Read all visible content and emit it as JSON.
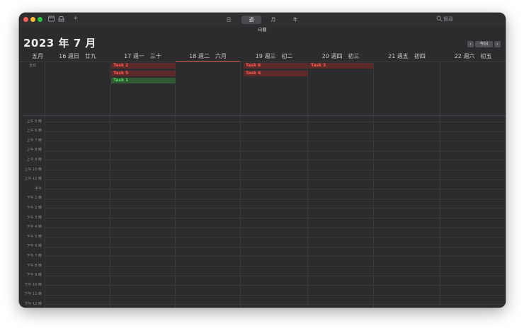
{
  "toolbar": {
    "views": [
      {
        "label": "日",
        "active": false
      },
      {
        "label": "週",
        "active": true
      },
      {
        "label": "月",
        "active": false
      },
      {
        "label": "年",
        "active": false
      }
    ],
    "add_label": "+",
    "search_label": "搜尋"
  },
  "subbar": {
    "label": "日曆"
  },
  "header": {
    "month_title": "2023 年 7 月",
    "prev": "‹",
    "today": "今日",
    "next": "›"
  },
  "days": [
    {
      "label": "五月"
    },
    {
      "label": "16 週日　廿九"
    },
    {
      "label": "17 週一　三十"
    },
    {
      "label": "18 週二　六月",
      "today": true
    },
    {
      "label": "19 週三　初二"
    },
    {
      "label": "20 週四　初三"
    },
    {
      "label": "21 週五　初四"
    },
    {
      "label": "22 週六　初五"
    }
  ],
  "allday_label": "全日",
  "hours": [
    "上午 5 時",
    "上午 6 時",
    "上午 7 時",
    "上午 8 時",
    "上午 9 時",
    "上午 10 時",
    "上午 11 時",
    "中午",
    "下午 1 時",
    "下午 2 時",
    "下午 3 時",
    "下午 4 時",
    "下午 5 時",
    "下午 6 時",
    "下午 7 時",
    "下午 8 時",
    "下午 9 時",
    "下午 10 時",
    "下午 11 時",
    "下午 12 時"
  ],
  "events": [
    {
      "name": "Task 2",
      "day": "17",
      "color": "#ff5a4e"
    },
    {
      "name": "Task 5",
      "day": "17",
      "color": "#ff5a4e"
    },
    {
      "name": "Task 1",
      "day": "17",
      "color": "#57d862"
    },
    {
      "name": "Task 6",
      "day": "19",
      "color": "#ff5a4e"
    },
    {
      "name": "Task 4",
      "day": "19",
      "color": "#ff5a4e"
    },
    {
      "name": "Task 3",
      "day": "20",
      "color": "#ff5a4e"
    }
  ],
  "colors": {
    "today_accent": "#e2564a",
    "event_red": "#ff5a4e",
    "event_green": "#57d862"
  }
}
